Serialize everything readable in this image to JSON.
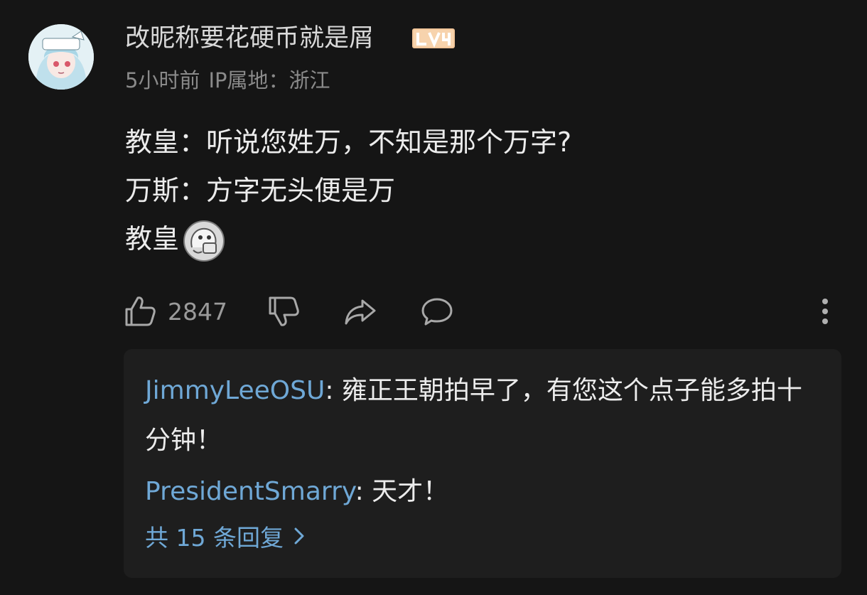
{
  "comment": {
    "username": "改昵称要花硬币就是屑",
    "level_badge": "LV4",
    "time": "5小时前",
    "ip_label": "IP属地：浙江",
    "lines": [
      "教皇：听说您姓万，不知是那个万字?",
      "万斯：方字无头便是万",
      "教皇"
    ],
    "sticker_icon": "ghost-sticker-icon"
  },
  "actions": {
    "like_count": "2847",
    "icons": [
      "thumbs-up-icon",
      "thumbs-down-icon",
      "share-icon",
      "reply-icon",
      "more-vertical-icon"
    ]
  },
  "replies": {
    "items": [
      {
        "author": "JimmyLeeOSU",
        "text": ": 雍正王朝拍早了，有您这个点子能多拍十分钟！"
      },
      {
        "author": "PresidentSmarry",
        "text": ": 天才！"
      }
    ],
    "more_label": "共 15 条回复"
  },
  "colors": {
    "background": "#151515",
    "reply_panel": "#1e1e1e",
    "author_link": "#6fa8d6",
    "level_badge": "#f2c69a"
  }
}
